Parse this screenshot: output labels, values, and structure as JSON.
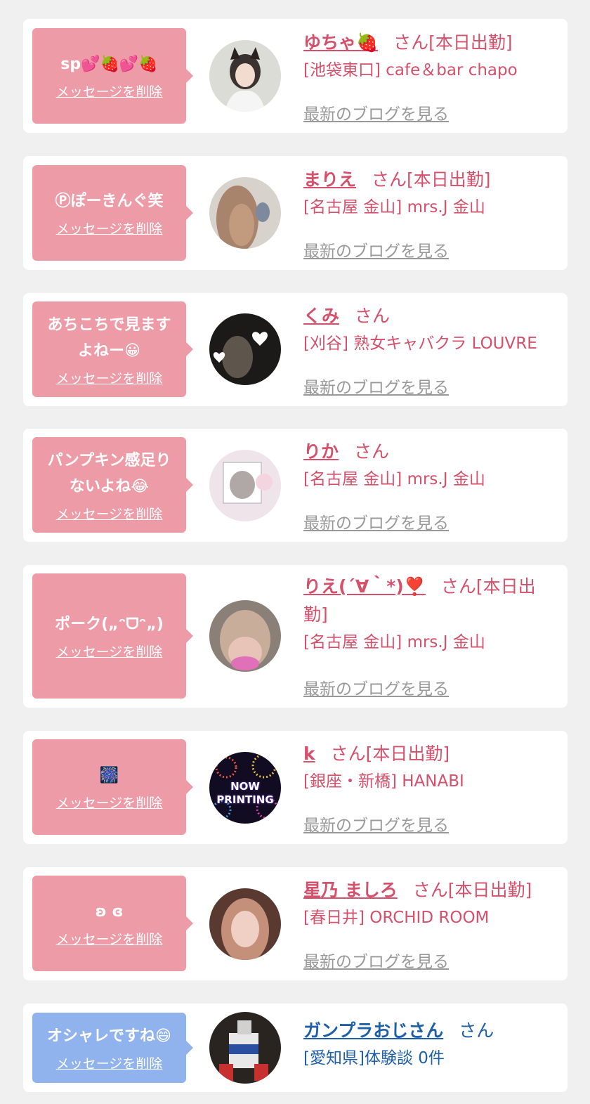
{
  "messages": [
    {
      "message": "sp💕🍓💕🍓",
      "delete_label": "メッセージを削除",
      "name": "ゆちゃ🍓",
      "suffix": "さん[本日出勤]",
      "shop": "[池袋東口] cafe＆bar chapo",
      "blog_link": "最新のブログを見る"
    },
    {
      "message": "Ⓟぽーきんぐ笑",
      "delete_label": "メッセージを削除",
      "name": "まりえ",
      "suffix": "さん[本日出勤]",
      "shop": "[名古屋 金山] mrs.J 金山",
      "blog_link": "最新のブログを見る"
    },
    {
      "message_line1": "あちこちで見ます",
      "message_line2": "よねー😀",
      "delete_label": "メッセージを削除",
      "name": "くみ",
      "suffix": "さん",
      "shop": "[刈谷] 熟女キャバクラ LOUVRE",
      "blog_link": "最新のブログを見る"
    },
    {
      "message_line1": "パンプキン感足り",
      "message_line2": "ないよね😂",
      "delete_label": "メッセージを削除",
      "name": "りか",
      "suffix": "さん",
      "shop": "[名古屋 金山] mrs.J 金山",
      "blog_link": "最新のブログを見る"
    },
    {
      "message": "ポーク(„ᵔᗜᵔ„)",
      "delete_label": "メッセージを削除",
      "name": "りえ(´∀｀*)❣️",
      "suffix_line1": "さん[本日出",
      "suffix_line2": "勤]",
      "shop": "[名古屋 金山] mrs.J 金山",
      "blog_link": "最新のブログを見る"
    },
    {
      "message": "🎆",
      "delete_label": "メッセージを削除",
      "name": "k",
      "suffix": "さん[本日出勤]",
      "shop": "[銀座・新橋] HANABI",
      "blog_link": "最新のブログを見る",
      "avatar_text": "NOW PRINTING"
    },
    {
      "message": "ʚ ɞ",
      "delete_label": "メッセージを削除",
      "name": "星乃 ましろ",
      "suffix": "さん[本日出勤]",
      "shop": "[春日井] ORCHID ROOM",
      "blog_link": "最新のブログを見る"
    },
    {
      "message": "オシャレですね😄",
      "delete_label": "メッセージを削除",
      "name": "ガンプラおじさん",
      "suffix": "さん",
      "shop": "[愛知県]体験談 0件"
    }
  ],
  "colors": {
    "pink_bubble": "#ee9ba8",
    "blue_bubble": "#90b3ee",
    "pink_text": "#d4506b",
    "blue_text": "#1f5fa8",
    "gray_link": "#999999"
  }
}
